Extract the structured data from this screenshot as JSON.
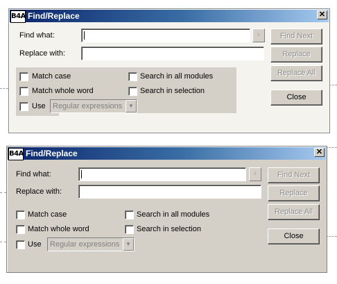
{
  "dialogs": [
    {
      "title": "Find/Replace",
      "app_icon_text": "B4A",
      "close_glyph": "✕",
      "find_label": "Find what:",
      "find_value": "",
      "replace_label": "Replace with:",
      "replace_value": "",
      "history_glyph": "›",
      "options": {
        "match_case": "Match case",
        "match_whole_word": "Match whole word",
        "use": "Use",
        "search_all_modules": "Search in all modules",
        "search_selection": "Search in selection",
        "regex_combo": "Regular expressions"
      },
      "buttons": {
        "find_next": "Find Next",
        "replace": "Replace",
        "replace_all": "Replace All",
        "close": "Close"
      }
    },
    {
      "title": "Find/Replace",
      "app_icon_text": "B4A",
      "close_glyph": "✕",
      "find_label": "Find what:",
      "find_value": "",
      "replace_label": "Replace with:",
      "replace_value": "",
      "history_glyph": "›",
      "options": {
        "match_case": "Match case",
        "match_whole_word": "Match whole word",
        "use": "Use",
        "search_all_modules": "Search in all modules",
        "search_selection": "Search in selection",
        "regex_combo": "Regular expressions"
      },
      "buttons": {
        "find_next": "Find Next",
        "replace": "Replace",
        "replace_all": "Replace All",
        "close": "Close"
      }
    }
  ]
}
